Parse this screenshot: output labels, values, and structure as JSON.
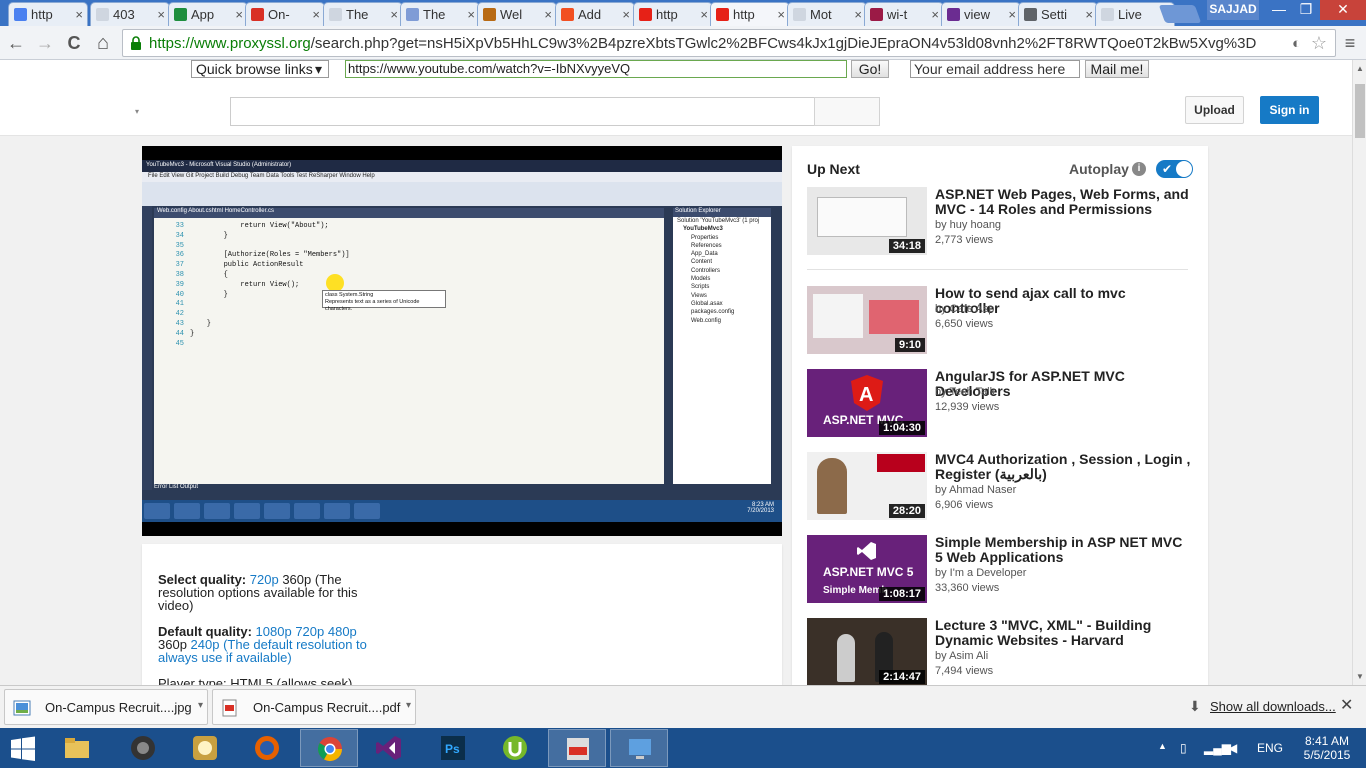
{
  "browser": {
    "tabs": [
      {
        "label": "http",
        "favicon_color": "#4a80f0"
      },
      {
        "label": "403",
        "favicon_color": "#cfd6e0"
      },
      {
        "label": "App",
        "favicon_color": "#1e8e3e"
      },
      {
        "label": "On-",
        "favicon_color": "#d93025"
      },
      {
        "label": "The",
        "favicon_color": "#cfd6e0"
      },
      {
        "label": "The",
        "favicon_color": "#7f9cd6"
      },
      {
        "label": "Wel",
        "favicon_color": "#b86a14"
      },
      {
        "label": "Add",
        "favicon_color": "#f25022"
      },
      {
        "label": "http",
        "favicon_color": "#e62117"
      },
      {
        "label": "http",
        "favicon_color": "#e62117"
      },
      {
        "label": "Mot",
        "favicon_color": "#cfd6e0"
      },
      {
        "label": "wi-t",
        "favicon_color": "#9b1a46"
      },
      {
        "label": "view",
        "favicon_color": "#6b2c91"
      },
      {
        "label": "Setti",
        "favicon_color": "#5f6368"
      },
      {
        "label": "Live",
        "favicon_color": "#cfd6e0"
      }
    ],
    "tab_close": "×",
    "profile_name": "SAJJAD",
    "win_min": "—",
    "win_max": "❐",
    "win_close": "✕",
    "back": "←",
    "forward": "→",
    "reload": "C",
    "home": "⌂",
    "url_scheme_host": "https://www.proxyssl.org",
    "url_rest": "/search.php?get=nsH5iXpVb5HhLC9w3%2B4pzreXbtsTGwlc2%2BFCws4kJx1gjDieJEpraON4v53ld08vnh2%2FT8RWTQoe0T2kBw5Xvg%3D",
    "menu": "≡"
  },
  "proxy": {
    "quick_browse": "Quick browse links",
    "url_value": "https://www.youtube.com/watch?v=-IbNXvyyeVQ",
    "go": "Go!",
    "email_placeholder": "Your email address here",
    "mail": "Mail me!"
  },
  "youtube": {
    "upload": "Upload",
    "sign_in": "Sign in",
    "caret": "▾"
  },
  "video": {
    "vs_title": "YouTubeMvc3 - Microsoft Visual Studio (Administrator)",
    "vs_menu": "File   Edit   View   Git   Project   Build   Debug   Team   Data   Tools   Test   ReSharper   Window   Help",
    "vs_tabs": "Web.config     About.cshtml     HomeController.cs",
    "code_lines": [
      {
        "n": "33",
        "code": "            return View(\"About\");"
      },
      {
        "n": "34",
        "code": "        }"
      },
      {
        "n": "35",
        "code": ""
      },
      {
        "n": "36",
        "code": "        [Authorize(Roles = \"Members\")]"
      },
      {
        "n": "37",
        "code": "        public ActionResult"
      },
      {
        "n": "38",
        "code": "        {"
      },
      {
        "n": "39",
        "code": "            return View();"
      },
      {
        "n": "40",
        "code": "        }"
      },
      {
        "n": "41",
        "code": ""
      },
      {
        "n": "42",
        "code": ""
      },
      {
        "n": "43",
        "code": "    }"
      },
      {
        "n": "44",
        "code": "}"
      },
      {
        "n": "45",
        "code": ""
      }
    ],
    "tooltip": "class System.String\nRepresents text as a series of Unicode characters.",
    "solution_head": "Solution Explorer",
    "solution_items": [
      "Solution 'YouTubeMvc3' (1 proj",
      "YouTubeMvc3",
      "Properties",
      "References",
      "App_Data",
      "Content",
      "Controllers",
      "Models",
      "Scripts",
      "Views",
      "Global.asax",
      "packages.config",
      "Web.config"
    ],
    "output_tabs": "Error List    Output",
    "vs_clock": "8:23 AM\n7/20/2013"
  },
  "panel": {
    "select_quality_label": "Select quality:",
    "select_quality_options": [
      "720p",
      "360p"
    ],
    "select_quality_note": "(The resolution options available for this video)",
    "default_quality_label": "Default quality:",
    "default_quality_options": [
      "1080p",
      "720p",
      "480p",
      "360p",
      "240p"
    ],
    "default_quality_note": "(The default resolution to always use if available)",
    "player_type": "Player type: HTML5 (allows seek)"
  },
  "upnext": {
    "heading": "Up Next",
    "autoplay": "Autoplay",
    "info": "i",
    "autoplay_on": true,
    "items": [
      {
        "title": "ASP.NET Web Pages, Web Forms, and MVC - 14 Roles and Permissions",
        "by": "by huy hoang",
        "views": "2,773 views",
        "duration": "34:18",
        "thumb_color": "#e8e8e8"
      },
      {
        "title": "How to send ajax call to mvc controller",
        "by": "by Cafe Asp",
        "views": "6,650 views",
        "duration": "9:10",
        "thumb_color": "#d9c8cc"
      },
      {
        "title": "AngularJS for ASP.NET MVC Developers",
        "by": "by Tech Talk",
        "views": "12,939 views",
        "duration": "1:04:30",
        "thumb_color": "#68217a"
      },
      {
        "title": "MVC4 Authorization , Session , Login , Register (بالعربية)",
        "by": "by Ahmad Naser",
        "views": "6,906 views",
        "duration": "28:20",
        "thumb_color": "#f0f0f0"
      },
      {
        "title": "Simple Membership in ASP NET MVC 5 Web Applications",
        "by": "by I'm a Developer",
        "views": "33,360 views",
        "duration": "1:08:17",
        "thumb_color": "#68217a"
      },
      {
        "title": "Lecture 3 \"MVC, XML\" - Building Dynamic Websites - Harvard",
        "by": "by Asim Ali",
        "views": "7,494 views",
        "duration": "2:14:47",
        "thumb_color": "#3a3028"
      }
    ],
    "thumb_text_angular": "ASP.NET MVC",
    "thumb_text_mvc5a": "ASP.NET MVC 5",
    "thumb_text_mvc5b": "Simple Memb"
  },
  "downloads": {
    "items": [
      {
        "name": "On-Campus Recruit....jpg"
      },
      {
        "name": "On-Campus Recruit....pdf"
      }
    ],
    "show_all": "Show all downloads...",
    "close": "✕"
  },
  "taskbar": {
    "lang": "ENG",
    "time": "8:41 AM",
    "date": "5/5/2015"
  }
}
